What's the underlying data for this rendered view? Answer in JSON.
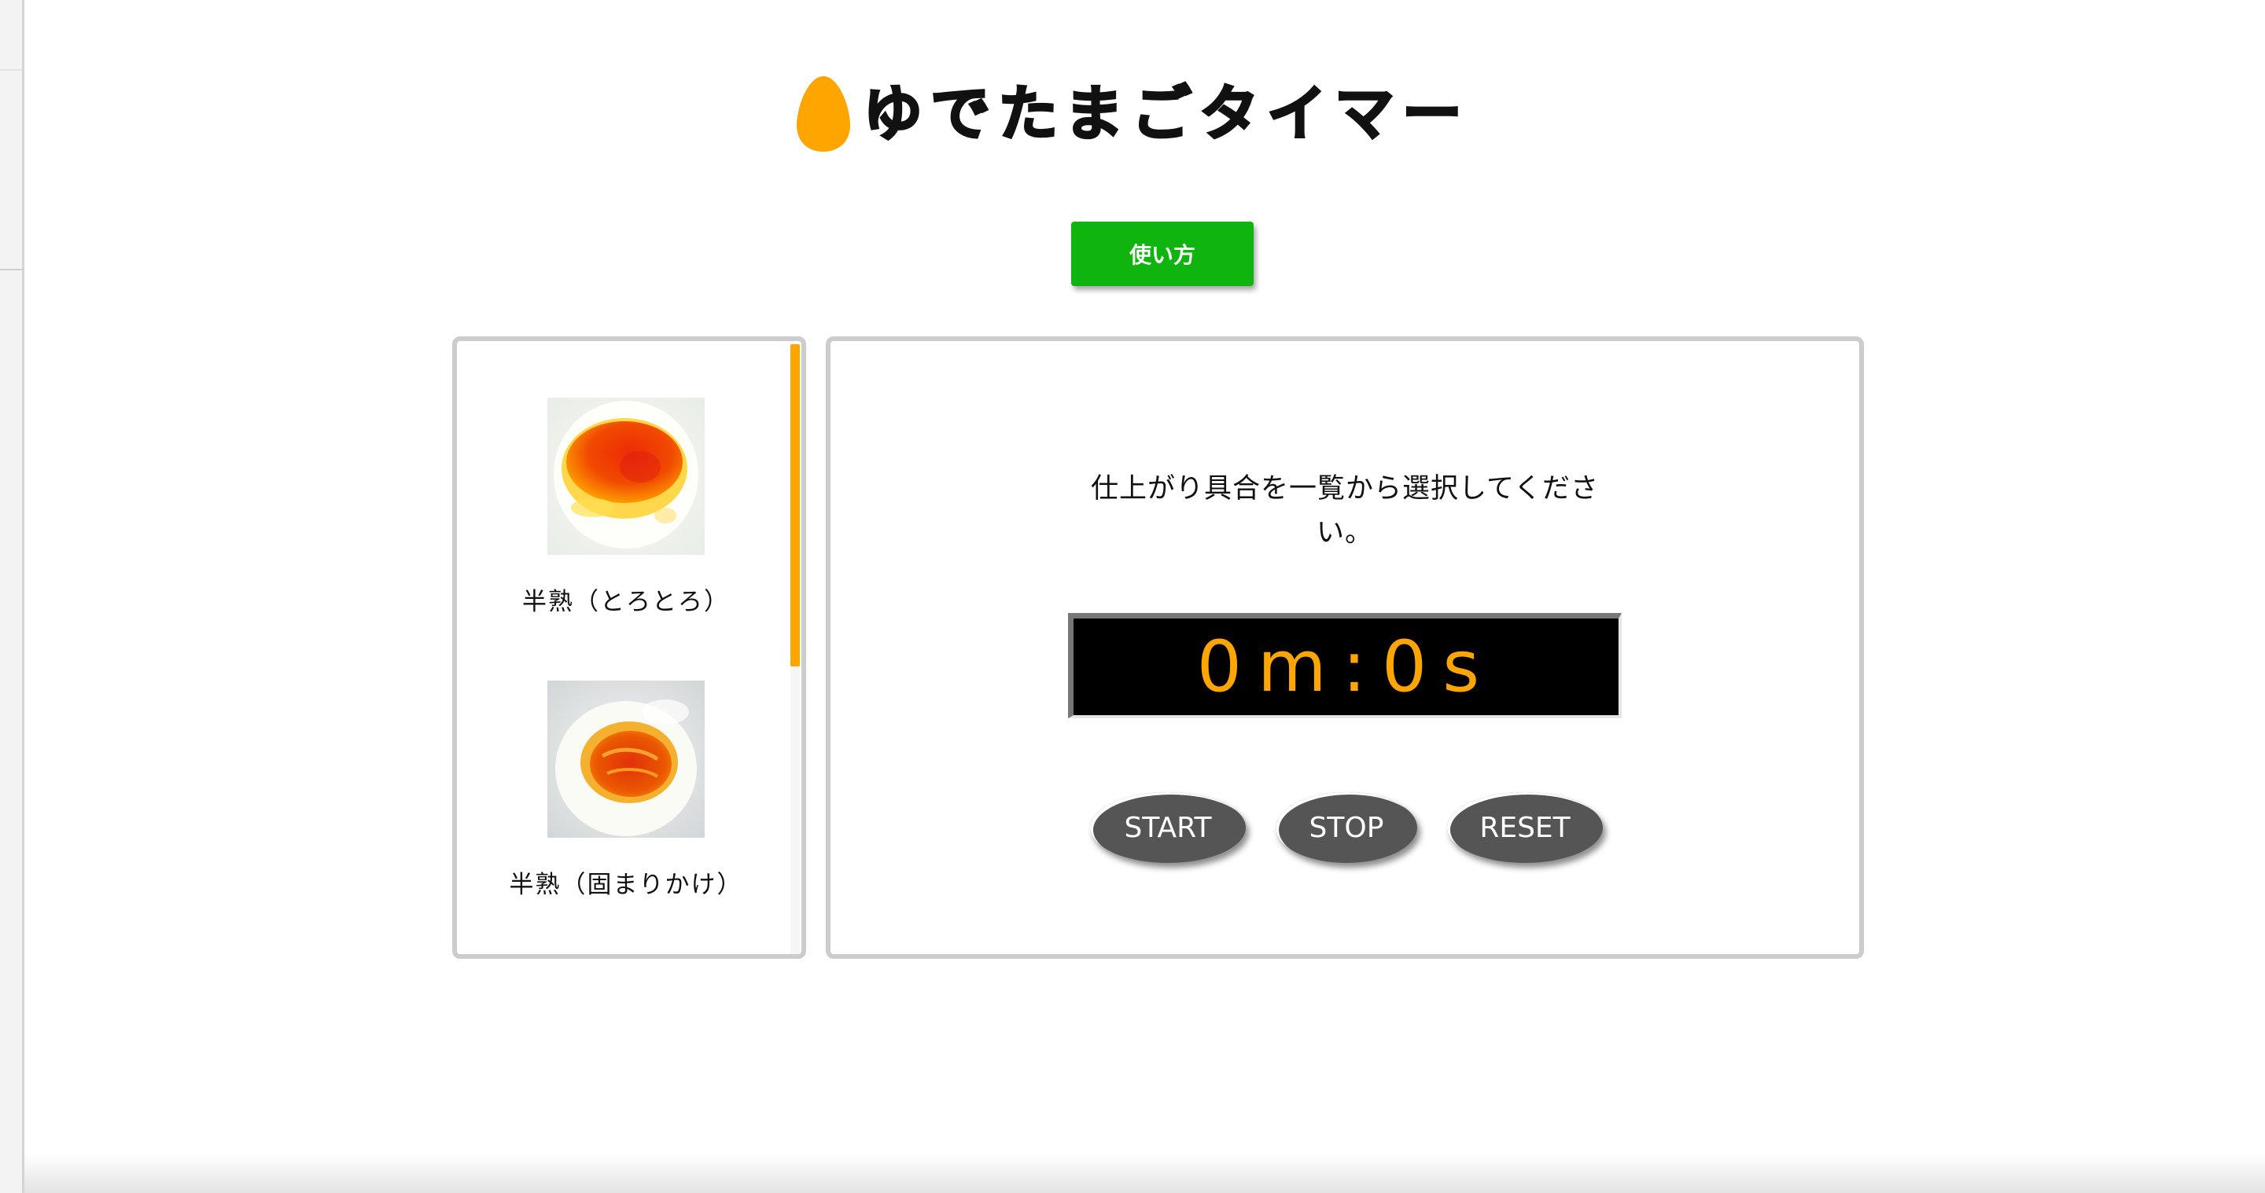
{
  "header": {
    "title": "ゆでたまごタイマー",
    "logo_icon": "egg-icon",
    "logo_color": "#ffa500"
  },
  "howto": {
    "label": "使い方",
    "color": "#0fb40f"
  },
  "menu": {
    "items": [
      {
        "label": "半熟（とろとろ）",
        "image": "soft-boiled-runny-egg-photo"
      },
      {
        "label": "半熟（固まりかけ）",
        "image": "soft-boiled-setting-egg-photo"
      }
    ],
    "scrollbar_color": "#ffa500"
  },
  "timer": {
    "instruction": "仕上がり具合を一覧から選択してください。",
    "display": "0m:0s",
    "display_color": "#ffa500",
    "buttons": {
      "start": "START",
      "stop": "STOP",
      "reset": "RESET"
    }
  }
}
